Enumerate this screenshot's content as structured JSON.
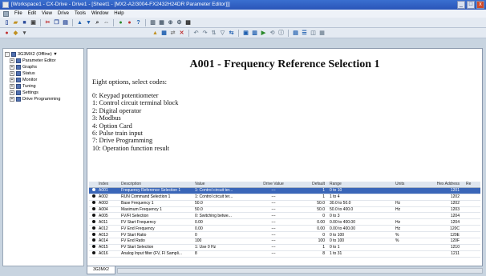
{
  "window": {
    "title": "[Workspace1 - CX-Drive - Drive1 - [Sheet1 - [MX2-A2/3004-FX2432H24DR Parameter Editor]]]",
    "min_label": "_",
    "max_label": "□",
    "close_label": "x"
  },
  "menu": [
    "File",
    "Edit",
    "View",
    "Drive",
    "Tools",
    "Window",
    "Help"
  ],
  "sidebar": {
    "items": [
      {
        "label": "3G3MX2 (Offline) ▼",
        "depth": 0,
        "expander": "-"
      },
      {
        "label": "Parameter Editor",
        "depth": 1,
        "expander": "+"
      },
      {
        "label": "Graphs",
        "depth": 1,
        "expander": "+"
      },
      {
        "label": "Status",
        "depth": 1,
        "expander": "+"
      },
      {
        "label": "Monitor",
        "depth": 1,
        "expander": "+"
      },
      {
        "label": "Tuning",
        "depth": 1,
        "expander": "+"
      },
      {
        "label": "Settings",
        "depth": 1,
        "expander": "+"
      },
      {
        "label": "Drive Programming",
        "depth": 1,
        "expander": "+"
      }
    ]
  },
  "help": {
    "title": "A001 - Frequency Reference Selection 1",
    "intro": "Eight options, select codes:",
    "options": [
      "0: Keypad potentiometer",
      "1: Control circuit terminal block",
      "2: Digital operator",
      "3: Modbus",
      "4: Option Card",
      "6: Pulse train input",
      "7: Drive Programming",
      "10: Operation function result"
    ]
  },
  "table": {
    "headers": {
      "index": "Index",
      "desc": "Description",
      "value": "Value",
      "drive": "Drive Value",
      "default": "Default",
      "range": "Range",
      "units": "Units",
      "hex": "Hex Address",
      "re": "Re"
    },
    "rows": [
      {
        "index": "A001",
        "desc": "Frequency Reference Selection 1",
        "value": "1: Control circuit ter...",
        "drive": "---",
        "default": "1",
        "range": "0  to 10",
        "units": "",
        "hex": "1201",
        "selected": true
      },
      {
        "index": "A002",
        "desc": "RUN Command Selection 1",
        "value": "1: Control circuit ter...",
        "drive": "---",
        "default": "1",
        "range": "1  to 4",
        "units": "",
        "hex": "1202"
      },
      {
        "index": "A003",
        "desc": "Base Frequency 1",
        "value": "50.0",
        "drive": "---",
        "default": "50.0",
        "range": "30.0  to 50.0",
        "units": "Hz",
        "hex": "1202"
      },
      {
        "index": "A004",
        "desc": "Maximum Frequency 1",
        "value": "50.0",
        "drive": "---",
        "default": "50.0",
        "range": "50.0  to 400.0",
        "units": "Hz",
        "hex": "1203"
      },
      {
        "index": "A005",
        "desc": "FV/FI Selection",
        "value": "0: Switching betwe...",
        "drive": "---",
        "default": "0",
        "range": "0  to 3",
        "units": "",
        "hex": "1204"
      },
      {
        "index": "A011",
        "desc": "FV Start Frequency",
        "value": "0.00",
        "drive": "---",
        "default": "0.00",
        "range": "0.00  to 400.00",
        "units": "Hz",
        "hex": "1204"
      },
      {
        "index": "A012",
        "desc": "FV End Frequency",
        "value": "0.00",
        "drive": "---",
        "default": "0.00",
        "range": "0.00  to 400.00",
        "units": "Hz",
        "hex": "120C"
      },
      {
        "index": "A013",
        "desc": "FV Start Ratio",
        "value": "0",
        "drive": "---",
        "default": "0",
        "range": "0  to 100",
        "units": "%",
        "hex": "120E"
      },
      {
        "index": "A014",
        "desc": "FV End Ratio",
        "value": "100",
        "drive": "---",
        "default": "100",
        "range": "0  to 100",
        "units": "%",
        "hex": "120F"
      },
      {
        "index": "A015",
        "desc": "FV Start Selection",
        "value": "1: Use 0 Hz",
        "drive": "---",
        "default": "1",
        "range": "0  to 1",
        "units": "",
        "hex": "1210"
      },
      {
        "index": "A016",
        "desc": "Analog Input filter (FV, FI Sampli...",
        "value": "8",
        "drive": "---",
        "default": "8",
        "range": "1  to 31",
        "units": "",
        "hex": "1211"
      }
    ]
  },
  "bottom_tab": {
    "label": "3G3MX2"
  },
  "colors": {
    "selected_row": "#3a66b8",
    "titlebar": "#2a55b8"
  }
}
